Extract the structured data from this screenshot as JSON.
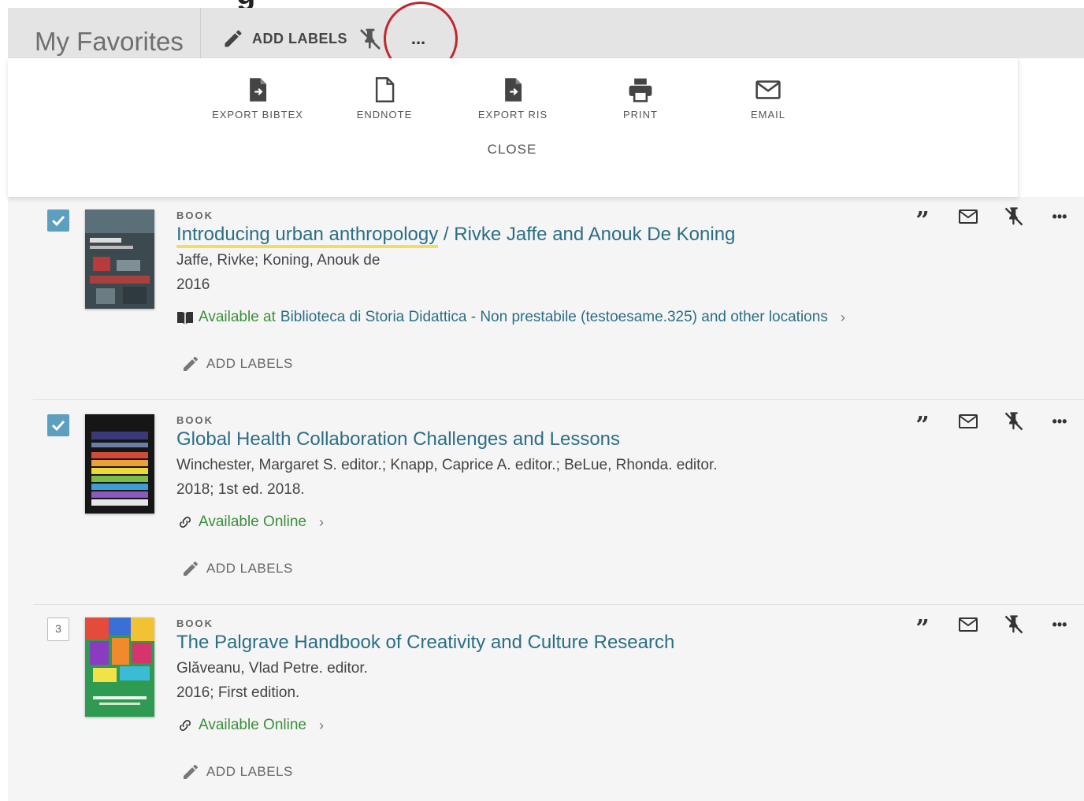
{
  "favorites_bar": {
    "title": "My Favorites",
    "add_labels": "ADD LABELS",
    "more": "..."
  },
  "actions_panel": {
    "items": [
      {
        "label": "EXPORT BIBTEX",
        "icon": "file-export-icon"
      },
      {
        "label": "ENDNOTE",
        "icon": "file-icon"
      },
      {
        "label": "EXPORT RIS",
        "icon": "file-export-icon"
      },
      {
        "label": "PRINT",
        "icon": "printer-icon"
      },
      {
        "label": "EMAIL",
        "icon": "envelope-icon"
      }
    ],
    "close": "CLOSE"
  },
  "records": [
    {
      "type": "BOOK",
      "title_main": "Introducing urban anthropology",
      "title_rest": " / Rivke Jaffe and Anouk De Koning",
      "authors": "Jaffe, Rivke; Koning, Anouk de",
      "year": "2016",
      "availability_status": "Available at",
      "availability_location": "Biblioteca di Storia  Didattica - Non prestabile (testoesame.325) and other locations",
      "add_labels": "ADD LABELS",
      "checked": true
    },
    {
      "type": "BOOK",
      "title_main": "Global Health Collaboration Challenges and Lessons",
      "title_rest": "",
      "authors": "Winchester, Margaret S. editor.; Knapp, Caprice A. editor.; BeLue, Rhonda. editor.",
      "year": "2018; 1st ed. 2018.",
      "availability_status": "Available Online",
      "add_labels": "ADD LABELS",
      "checked": true
    },
    {
      "type": "BOOK",
      "title_main": "The Palgrave Handbook of Creativity and Culture Research",
      "title_rest": "",
      "authors": "Glăveanu, Vlad Petre. editor.",
      "year": "2016; First edition.",
      "availability_status": "Available Online",
      "add_labels": "ADD LABELS",
      "number": "3"
    }
  ],
  "record_action_icons": [
    "quote-icon",
    "email-icon",
    "unpin-icon",
    "more-icon"
  ],
  "colors": {
    "link": "#2b6e86",
    "available": "#3a8f3a",
    "checkbox": "#5c9fbe",
    "highlight": "#f5dd5c",
    "annotation": "#c0272d"
  }
}
